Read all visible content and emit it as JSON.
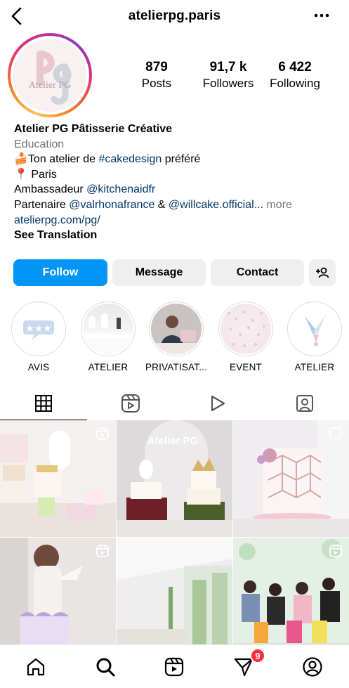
{
  "header": {
    "username": "atelierpg.paris"
  },
  "profile": {
    "avatar_text": "Atelier PG",
    "stats": [
      {
        "value": "879",
        "label": "Posts"
      },
      {
        "value": "91,7 k",
        "label": "Followers"
      },
      {
        "value": "6 422",
        "label": "Following"
      }
    ]
  },
  "bio": {
    "name": "Atelier PG Pâtisserie Créative",
    "category": "Education",
    "line1_emoji": "🍰",
    "line1_text": "Ton atelier de ",
    "line1_hashtag": "#cakedesign",
    "line1_end": " préféré",
    "line2_emoji": "📍",
    "line2_text": "Paris",
    "line3_text": "Ambassadeur ",
    "line3_mention": "@kitchenaidfr",
    "line4_text": "Partenaire ",
    "line4_mention1": "@valrhonafrance",
    "line4_and": " & ",
    "line4_mention2": "@willcake.official...",
    "line4_more": " more",
    "website": "atelierpg.com/pg/",
    "translate": "See Translation"
  },
  "actions": {
    "follow": "Follow",
    "message": "Message",
    "contact": "Contact"
  },
  "highlights": [
    {
      "label": "AVIS"
    },
    {
      "label": "ATELIER"
    },
    {
      "label": "PRIVATISAT..."
    },
    {
      "label": "EVENT"
    },
    {
      "label": "ATELIER"
    }
  ],
  "grid": {
    "post_watermark": "Atelier PG"
  },
  "bottom_nav": {
    "messages_badge": "9"
  },
  "colors": {
    "accent": "#0095f6",
    "link": "#00376b",
    "badge": "#ff3040"
  }
}
